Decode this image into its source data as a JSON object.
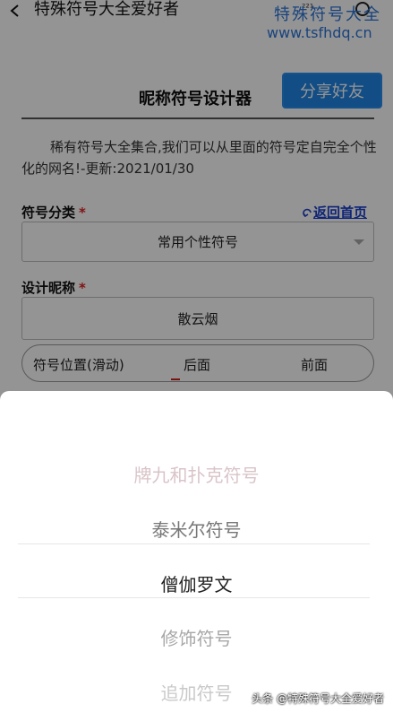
{
  "nav": {
    "title": "特殊符号大全爱好者",
    "status_text": "²²¹"
  },
  "watermark": {
    "line1": "特殊符号大全",
    "line2": "www.tsfhdq.cn"
  },
  "header": {
    "title": "昵称符号设计器",
    "share_label": "分享好友"
  },
  "intro": "稀有符号大全集合,我们可以从里面的符号定自完全个性化的网名!-更新:2021/01/30",
  "form": {
    "category_label": "符号分类",
    "required_mark": "*",
    "home_link": "返回首页",
    "category_value": "常用个性符号",
    "name_label": "设计昵称",
    "name_value": "散云烟",
    "position_label": "符号位置(滑动)",
    "position_back": "后面",
    "position_front": "前面"
  },
  "picker": {
    "items": [
      {
        "label": "牌九和扑克符号",
        "color": "#d9c4c8"
      },
      {
        "label": "泰米尔符号",
        "color": "#777777"
      },
      {
        "label": "僧伽罗文",
        "color": "#222222"
      },
      {
        "label": "修饰符号",
        "color": "#a8a8a8"
      },
      {
        "label": "追加符号",
        "color": "#c9c9c9"
      }
    ],
    "selected_index": 2
  },
  "credit": "头条 @特殊符号大全爱好者",
  "colors": {
    "accent": "#1f86e6",
    "link": "#1a3fcc",
    "required": "#e02020",
    "watermark": "#2c74d8"
  }
}
